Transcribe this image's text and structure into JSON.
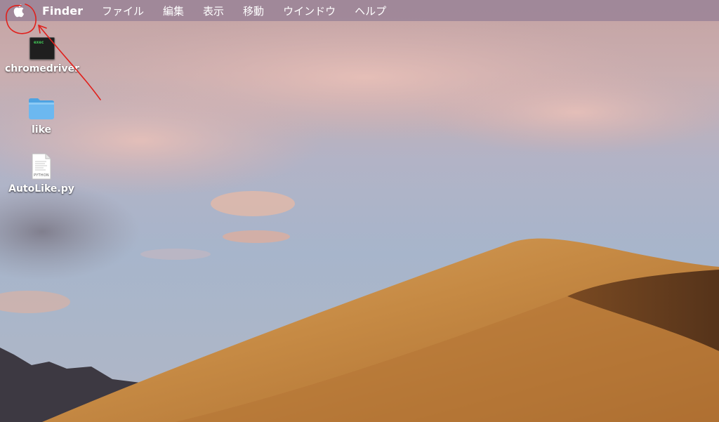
{
  "menubar": {
    "apple_icon": "apple-icon",
    "app_name": "Finder",
    "items": [
      "ファイル",
      "編集",
      "表示",
      "移動",
      "ウインドウ",
      "ヘルプ"
    ]
  },
  "desktop": {
    "icons": [
      {
        "label": "chromedriver",
        "icon": "terminal-exec-icon",
        "badge": "exec"
      },
      {
        "label": "like",
        "icon": "folder-icon"
      },
      {
        "label": "AutoLike.py",
        "icon": "python-document-icon",
        "badge": "PYTHON"
      }
    ]
  },
  "annotation": {
    "color": "#e0201c",
    "marks": [
      "circle around apple-icon",
      "arrow pointing to apple-icon"
    ]
  },
  "colors": {
    "menubar_bg": "#96809a",
    "folder": "#6cb8f0",
    "dune": "#c98a45"
  }
}
